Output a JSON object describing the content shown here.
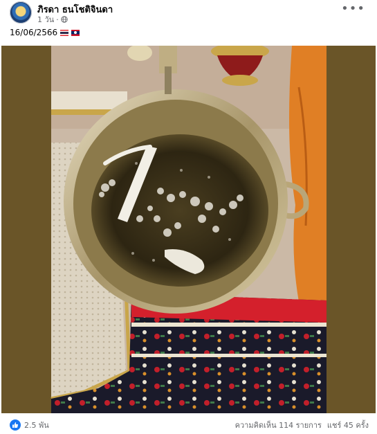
{
  "post": {
    "author": "ภิรดา ธนโชติจินดา",
    "time": "1 วัน",
    "privacy_icon": "globe-icon",
    "more_icon": "more-options-icon",
    "caption_text": "16/06/2566",
    "caption_flags": [
      "thailand-flag",
      "laos-flag"
    ]
  },
  "reactions": {
    "icon": "like-icon",
    "count": "2.5 พัน"
  },
  "engagement": {
    "comments": "ความคิดเห็น 114 รายการ",
    "shares": "แชร์ 45 ครั้ง"
  },
  "colors": {
    "text_primary": "#050505",
    "text_secondary": "#65676b",
    "like_blue": "#1877f2"
  }
}
